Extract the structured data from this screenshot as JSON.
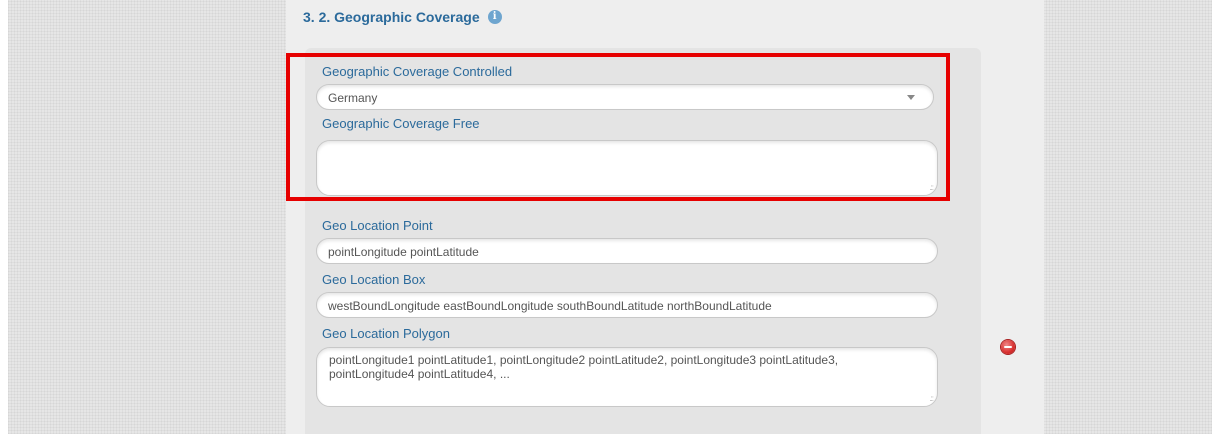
{
  "section": {
    "title": "3. 2. Geographic Coverage",
    "info_icon": "info-icon"
  },
  "fields": {
    "coverage_controlled": {
      "label": "Geographic Coverage Controlled",
      "value": "Germany"
    },
    "coverage_free": {
      "label": "Geographic Coverage Free",
      "value": ""
    },
    "geo_point": {
      "label": "Geo Location Point",
      "placeholder": "pointLongitude pointLatitude"
    },
    "geo_box": {
      "label": "Geo Location Box",
      "placeholder": "westBoundLongitude eastBoundLongitude southBoundLatitude northBoundLatitude"
    },
    "geo_polygon": {
      "label": "Geo Location Polygon",
      "placeholder": "pointLongitude1 pointLatitude1, pointLongitude2 pointLatitude2, pointLongitude3 pointLatitude3, pointLongitude4 pointLatitude4, ..."
    }
  },
  "actions": {
    "remove_icon": "remove-icon"
  },
  "colors": {
    "label": "#2b6a9b",
    "highlight": "#e60000",
    "remove": "#d9302f",
    "info": "#6ea5cf"
  }
}
